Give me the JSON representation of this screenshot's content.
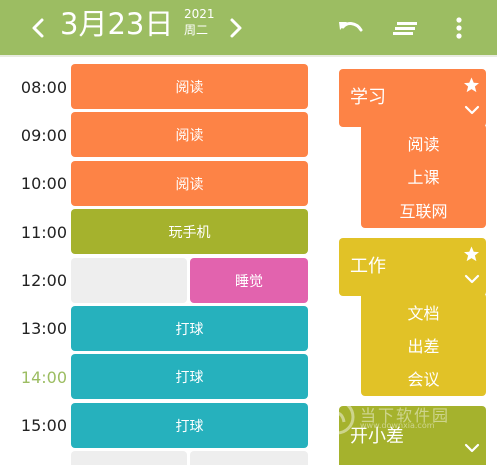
{
  "header": {
    "date_main": "3月23日",
    "year": "2021",
    "weekday": "周二",
    "bg_color": "#9cbd62",
    "icons": [
      "chevron-left-icon",
      "chevron-right-icon",
      "undo-icon",
      "sort-lines-icon",
      "more-vertical-icon"
    ]
  },
  "timeline": {
    "times": [
      "08:00",
      "09:00",
      "10:00",
      "11:00",
      "12:00",
      "13:00",
      "14:00",
      "15:00"
    ],
    "current_time": "14:00",
    "current_color": "#9cbd62",
    "blocks": [
      {
        "label": "阅读",
        "color": "#fd8346"
      },
      {
        "label": "阅读",
        "color": "#fd8346"
      },
      {
        "label": "阅读",
        "color": "#fd8346"
      },
      {
        "label": "玩手机",
        "color": "#a5b22d"
      },
      {
        "label": "睡觉",
        "color": "#e263ae"
      },
      {
        "label": "打球",
        "color": "#26b1bd"
      },
      {
        "label": "打球",
        "color": "#26b1bd"
      },
      {
        "label": "打球",
        "color": "#26b1bd"
      }
    ]
  },
  "categories": [
    {
      "title": "学习",
      "color": "#fd8346",
      "items": [
        "阅读",
        "上课",
        "互联网"
      ],
      "starred": true
    },
    {
      "title": "工作",
      "color": "#e1c227",
      "items": [
        "文档",
        "出差",
        "会议"
      ],
      "starred": true
    },
    {
      "title": "开小差",
      "color": "#a5b22d",
      "items": [],
      "starred": false
    }
  ],
  "watermark": {
    "text": "当下软件园",
    "sub": "www.downxia.com"
  }
}
